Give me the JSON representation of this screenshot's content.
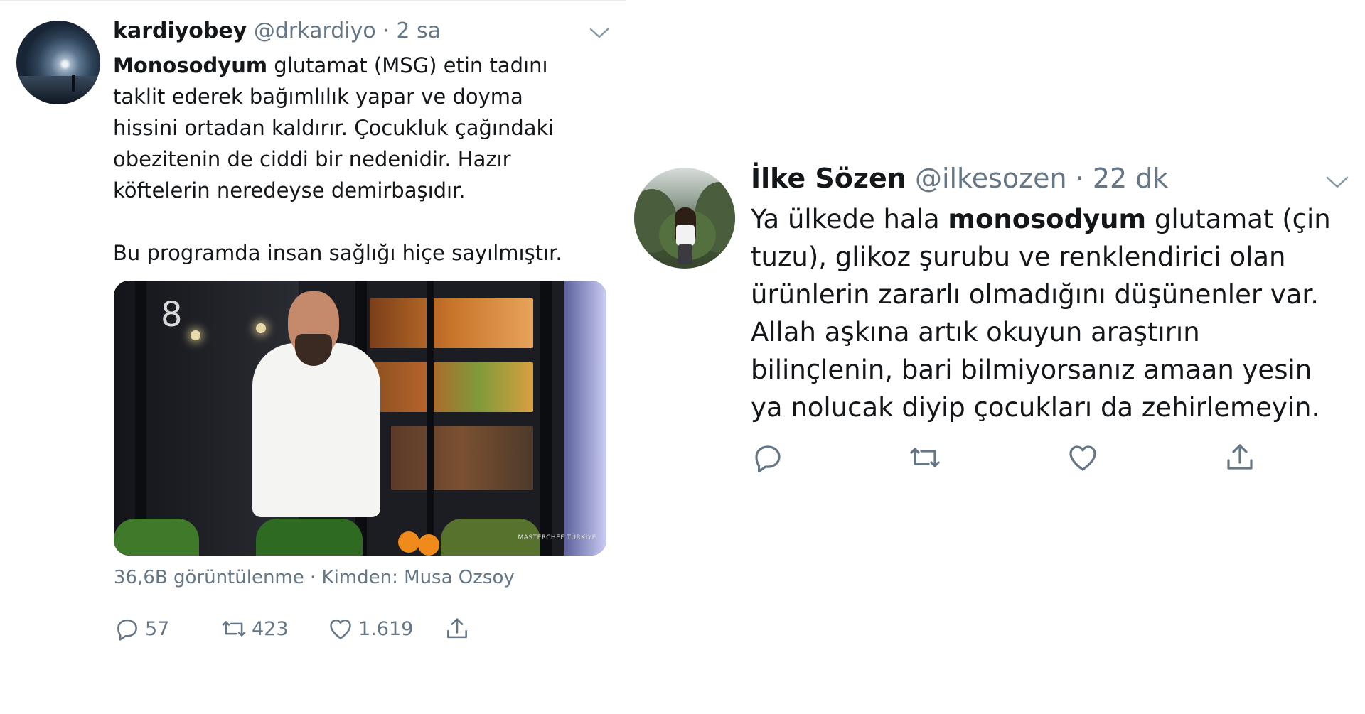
{
  "tweet1": {
    "author_name": "kardiyobey",
    "handle": "@drkardiyo",
    "separator": "·",
    "time": "2 sa",
    "body_bold": "Monosodyum",
    "body_lines": [
      " glutamat (MSG) etin tadını",
      "taklit ederek bağımlılık yapar ve doyma",
      "hissini ortadan kaldırır. Çocukluk çağındaki",
      "obezitenin de ciddi bir nedenidir. Hazır",
      "köftelerin neredeyse demirbaşıdır."
    ],
    "body_paragraph2": "Bu programda insan sağlığı hiçe sayılmıştır.",
    "media_overlay_number": "8",
    "media_watermark": "MASTERCHEF TÜRKİYE",
    "views_line": "36,6B görüntülenme · Kimden: Musa Ozsoy",
    "actions": {
      "reply_count": "57",
      "retweet_count": "423",
      "like_count": "1.619"
    }
  },
  "tweet2": {
    "author_name": "İlke Sözen",
    "handle": "@ilkesozen",
    "separator": "·",
    "time": "22 dk",
    "line1_pre": "Ya ülkede hala ",
    "line1_bold": "monosodyum",
    "line1_post": " glutamat (çin",
    "lines": [
      "tuzu), glikoz şurubu ve renklendirici olan",
      "ürünlerin zararlı olmadığını düşünenler var.",
      "Allah aşkına artık okuyun araştırın",
      "bilinçlenin, bari bilmiyorsanız amaan yesin",
      "ya nolucak diyip çocukları da zehirlemeyin."
    ]
  },
  "colors": {
    "text": "#14171a",
    "muted": "#657786",
    "divider": "#e6ecf0"
  },
  "icons": [
    "reply-icon",
    "retweet-icon",
    "like-icon",
    "share-icon",
    "chevron-down-icon"
  ]
}
